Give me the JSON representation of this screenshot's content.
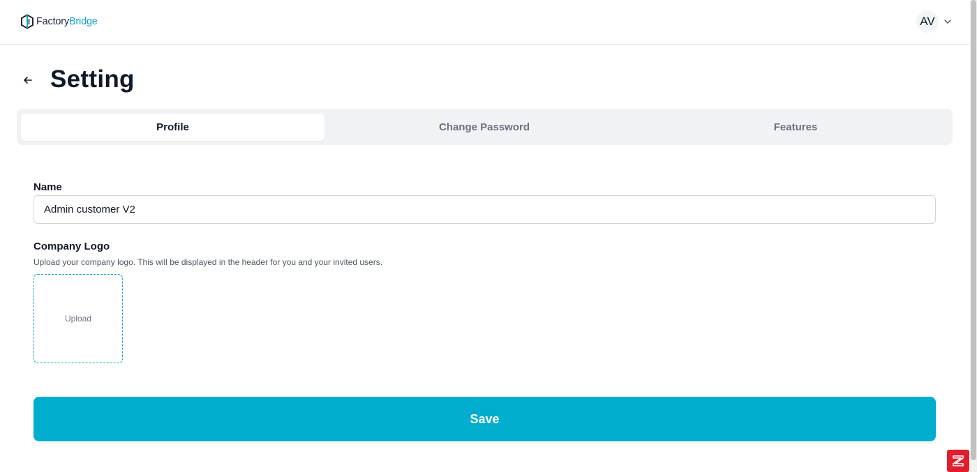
{
  "header": {
    "logo_part1": "Factory",
    "logo_part2": "Bridge",
    "user_initials": "AV"
  },
  "page": {
    "title": "Setting"
  },
  "tabs": [
    {
      "label": "Profile",
      "active": true
    },
    {
      "label": "Change Password",
      "active": false
    },
    {
      "label": "Features",
      "active": false
    }
  ],
  "form": {
    "name_label": "Name",
    "name_value": "Admin customer V2",
    "logo_label": "Company Logo",
    "logo_help": "Upload your company logo. This will be displayed in the header for you and your invited users.",
    "upload_label": "Upload",
    "save_label": "Save"
  },
  "icons": {
    "back": "arrow-left-icon",
    "user_menu": "chevron-down-icon",
    "logo": "hexagon-logo-icon",
    "widget": "support-widget-icon"
  },
  "colors": {
    "accent": "#00adcf",
    "brand_text": "#0ea5c9",
    "widget": "#e11d2e"
  }
}
